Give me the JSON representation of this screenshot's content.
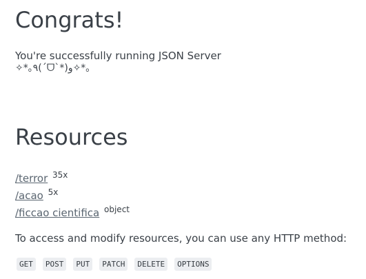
{
  "congrats": {
    "title": "Congrats!",
    "message": "You're successfully running JSON Server",
    "kaomoji": "✧*｡٩(ˊᗜˋ*)و✧*｡"
  },
  "resources": {
    "title": "Resources",
    "items": [
      {
        "path": "/terror",
        "meta": "35x"
      },
      {
        "path": "/acao",
        "meta": "5x"
      },
      {
        "path": "/ficcao cientifica",
        "meta": "object"
      }
    ]
  },
  "access": {
    "text": "To access and modify resources, you can use any HTTP method:",
    "methods": [
      "GET",
      "POST",
      "PUT",
      "PATCH",
      "DELETE",
      "OPTIONS"
    ]
  }
}
